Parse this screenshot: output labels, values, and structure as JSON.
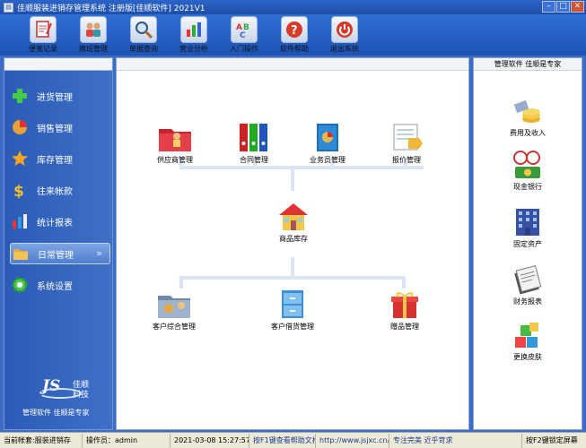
{
  "window": {
    "title": "佳顺服装进销存管理系统 注册版[佳顺软件] 2021V1",
    "app_icon": "app-icon"
  },
  "toolbar": {
    "items": [
      {
        "label": "便笺记录",
        "icon": "notepad-icon"
      },
      {
        "label": "换班管理",
        "icon": "users-icon"
      },
      {
        "label": "单据查询",
        "icon": "magnifier-icon"
      },
      {
        "label": "营业分析",
        "icon": "bar-chart-icon"
      },
      {
        "label": "入门操作",
        "icon": "abc-blocks-icon"
      },
      {
        "label": "软件帮助",
        "icon": "help-icon"
      },
      {
        "label": "退出系统",
        "icon": "power-icon"
      }
    ]
  },
  "sidebar": {
    "items": [
      {
        "label": "进货管理",
        "icon": "plus-icon"
      },
      {
        "label": "销售管理",
        "icon": "pie-chart-icon"
      },
      {
        "label": "库存管理",
        "icon": "star-icon"
      },
      {
        "label": "往来帐款",
        "icon": "dollar-icon"
      },
      {
        "label": "统计报表",
        "icon": "bar-chart-icon"
      },
      {
        "label": "日常管理",
        "icon": "folder-icon",
        "active": true,
        "chevron": "»"
      },
      {
        "label": "系统设置",
        "icon": "gear-icon"
      }
    ],
    "logo_text": "JS",
    "brand_line1": "佳顺",
    "brand_line2": "科技",
    "slogan": "管理软件 佳顺是专家"
  },
  "center": {
    "top_nodes": [
      {
        "label": "供应商管理",
        "icon": "supplier-folder-icon"
      },
      {
        "label": "合同管理",
        "icon": "binders-icon"
      },
      {
        "label": "业务员管理",
        "icon": "book-icon"
      },
      {
        "label": "报价管理",
        "icon": "price-tag-icon"
      }
    ],
    "hub": {
      "label": "商品库存",
      "icon": "house-icon"
    },
    "bottom_nodes": [
      {
        "label": "客户综合管理",
        "icon": "customer-folder-icon"
      },
      {
        "label": "客户借货管理",
        "icon": "cabinet-icon"
      },
      {
        "label": "赠品管理",
        "icon": "gift-icon"
      }
    ]
  },
  "right": {
    "header": "管理软件 佳顺是专家",
    "items": [
      {
        "label": "费用及收入",
        "icon": "coins-icon"
      },
      {
        "label": "现金银行",
        "icon": "cash-icon"
      },
      {
        "label": "固定资产",
        "icon": "building-icon"
      },
      {
        "label": "财务报表",
        "icon": "report-icon"
      },
      {
        "label": "更换皮肤",
        "icon": "cubes-icon"
      }
    ]
  },
  "status": {
    "account": "当前帐套:服装进销存",
    "operator": "操作员：admin",
    "datetime": "2021-03-08 15:27:57",
    "help": "按F1键查看帮助文档",
    "url": "http://www.jsjxc.cn/",
    "motto": "专注完美 近乎苛求",
    "lock": "按F2键锁定屏幕"
  }
}
